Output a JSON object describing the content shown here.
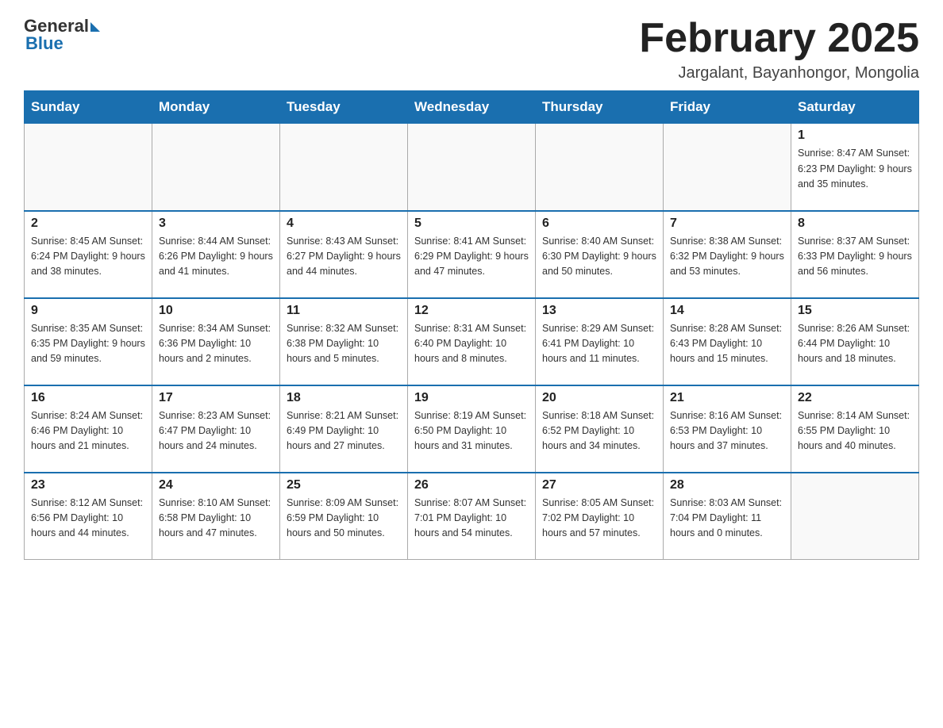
{
  "logo": {
    "general": "General",
    "blue": "Blue"
  },
  "title": "February 2025",
  "subtitle": "Jargalant, Bayanhongor, Mongolia",
  "weekdays": [
    "Sunday",
    "Monday",
    "Tuesday",
    "Wednesday",
    "Thursday",
    "Friday",
    "Saturday"
  ],
  "weeks": [
    [
      {
        "day": "",
        "info": ""
      },
      {
        "day": "",
        "info": ""
      },
      {
        "day": "",
        "info": ""
      },
      {
        "day": "",
        "info": ""
      },
      {
        "day": "",
        "info": ""
      },
      {
        "day": "",
        "info": ""
      },
      {
        "day": "1",
        "info": "Sunrise: 8:47 AM\nSunset: 6:23 PM\nDaylight: 9 hours\nand 35 minutes."
      }
    ],
    [
      {
        "day": "2",
        "info": "Sunrise: 8:45 AM\nSunset: 6:24 PM\nDaylight: 9 hours\nand 38 minutes."
      },
      {
        "day": "3",
        "info": "Sunrise: 8:44 AM\nSunset: 6:26 PM\nDaylight: 9 hours\nand 41 minutes."
      },
      {
        "day": "4",
        "info": "Sunrise: 8:43 AM\nSunset: 6:27 PM\nDaylight: 9 hours\nand 44 minutes."
      },
      {
        "day": "5",
        "info": "Sunrise: 8:41 AM\nSunset: 6:29 PM\nDaylight: 9 hours\nand 47 minutes."
      },
      {
        "day": "6",
        "info": "Sunrise: 8:40 AM\nSunset: 6:30 PM\nDaylight: 9 hours\nand 50 minutes."
      },
      {
        "day": "7",
        "info": "Sunrise: 8:38 AM\nSunset: 6:32 PM\nDaylight: 9 hours\nand 53 minutes."
      },
      {
        "day": "8",
        "info": "Sunrise: 8:37 AM\nSunset: 6:33 PM\nDaylight: 9 hours\nand 56 minutes."
      }
    ],
    [
      {
        "day": "9",
        "info": "Sunrise: 8:35 AM\nSunset: 6:35 PM\nDaylight: 9 hours\nand 59 minutes."
      },
      {
        "day": "10",
        "info": "Sunrise: 8:34 AM\nSunset: 6:36 PM\nDaylight: 10 hours\nand 2 minutes."
      },
      {
        "day": "11",
        "info": "Sunrise: 8:32 AM\nSunset: 6:38 PM\nDaylight: 10 hours\nand 5 minutes."
      },
      {
        "day": "12",
        "info": "Sunrise: 8:31 AM\nSunset: 6:40 PM\nDaylight: 10 hours\nand 8 minutes."
      },
      {
        "day": "13",
        "info": "Sunrise: 8:29 AM\nSunset: 6:41 PM\nDaylight: 10 hours\nand 11 minutes."
      },
      {
        "day": "14",
        "info": "Sunrise: 8:28 AM\nSunset: 6:43 PM\nDaylight: 10 hours\nand 15 minutes."
      },
      {
        "day": "15",
        "info": "Sunrise: 8:26 AM\nSunset: 6:44 PM\nDaylight: 10 hours\nand 18 minutes."
      }
    ],
    [
      {
        "day": "16",
        "info": "Sunrise: 8:24 AM\nSunset: 6:46 PM\nDaylight: 10 hours\nand 21 minutes."
      },
      {
        "day": "17",
        "info": "Sunrise: 8:23 AM\nSunset: 6:47 PM\nDaylight: 10 hours\nand 24 minutes."
      },
      {
        "day": "18",
        "info": "Sunrise: 8:21 AM\nSunset: 6:49 PM\nDaylight: 10 hours\nand 27 minutes."
      },
      {
        "day": "19",
        "info": "Sunrise: 8:19 AM\nSunset: 6:50 PM\nDaylight: 10 hours\nand 31 minutes."
      },
      {
        "day": "20",
        "info": "Sunrise: 8:18 AM\nSunset: 6:52 PM\nDaylight: 10 hours\nand 34 minutes."
      },
      {
        "day": "21",
        "info": "Sunrise: 8:16 AM\nSunset: 6:53 PM\nDaylight: 10 hours\nand 37 minutes."
      },
      {
        "day": "22",
        "info": "Sunrise: 8:14 AM\nSunset: 6:55 PM\nDaylight: 10 hours\nand 40 minutes."
      }
    ],
    [
      {
        "day": "23",
        "info": "Sunrise: 8:12 AM\nSunset: 6:56 PM\nDaylight: 10 hours\nand 44 minutes."
      },
      {
        "day": "24",
        "info": "Sunrise: 8:10 AM\nSunset: 6:58 PM\nDaylight: 10 hours\nand 47 minutes."
      },
      {
        "day": "25",
        "info": "Sunrise: 8:09 AM\nSunset: 6:59 PM\nDaylight: 10 hours\nand 50 minutes."
      },
      {
        "day": "26",
        "info": "Sunrise: 8:07 AM\nSunset: 7:01 PM\nDaylight: 10 hours\nand 54 minutes."
      },
      {
        "day": "27",
        "info": "Sunrise: 8:05 AM\nSunset: 7:02 PM\nDaylight: 10 hours\nand 57 minutes."
      },
      {
        "day": "28",
        "info": "Sunrise: 8:03 AM\nSunset: 7:04 PM\nDaylight: 11 hours\nand 0 minutes."
      },
      {
        "day": "",
        "info": ""
      }
    ]
  ]
}
